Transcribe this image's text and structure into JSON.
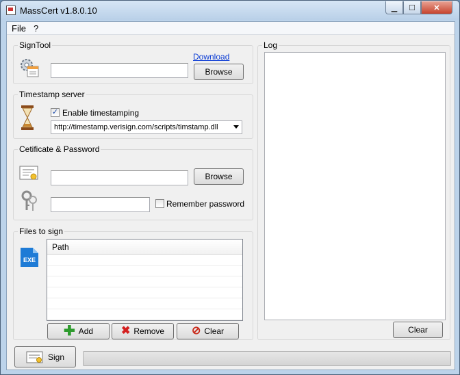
{
  "window": {
    "title": "MassCert v1.8.0.10"
  },
  "menu": {
    "file": "File",
    "help": "?"
  },
  "signtool": {
    "group_label": "SignTool",
    "path_value": "",
    "download_link": "Download",
    "browse_label": "Browse"
  },
  "timestamp": {
    "group_label": "Timestamp server",
    "enable_label": "Enable timestamping",
    "enable_checked": "✓",
    "server_value": "http://timestamp.verisign.com/scripts/timstamp.dll"
  },
  "certificate": {
    "group_label": "Cetificate & Password",
    "cert_path_value": "",
    "browse_label": "Browse",
    "password_value": "",
    "remember_label": "Remember password",
    "remember_checked": ""
  },
  "files": {
    "group_label": "Files to sign",
    "icon_text": "EXE",
    "column_path": "Path",
    "rows": [
      "",
      "",
      "",
      "",
      "",
      ""
    ],
    "add_label": "Add",
    "remove_label": "Remove",
    "clear_label": "Clear"
  },
  "log": {
    "group_label": "Log",
    "clear_label": "Clear"
  },
  "footer": {
    "sign_label": "Sign",
    "progress": 0
  },
  "colors": {
    "add": "#2e9b2e",
    "remove": "#d42020",
    "clear": "#c92a1a",
    "link": "#0a3bd4"
  }
}
